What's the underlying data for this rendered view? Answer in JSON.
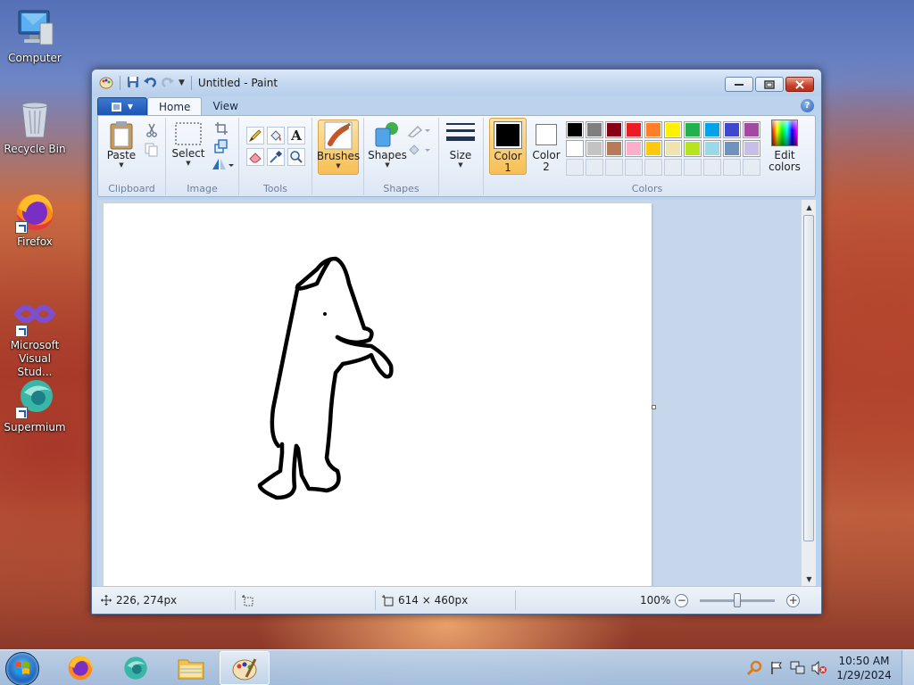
{
  "desktop": {
    "icons": [
      {
        "label": "Computer"
      },
      {
        "label": "Recycle Bin"
      },
      {
        "label": "Firefox"
      },
      {
        "label": "Microsoft Visual Stud..."
      },
      {
        "label": "Supermium"
      }
    ]
  },
  "window": {
    "title": "Untitled - Paint",
    "tabs": [
      {
        "label": "Home"
      },
      {
        "label": "View"
      }
    ],
    "groups": {
      "clipboard": {
        "label": "Clipboard",
        "paste": "Paste"
      },
      "image": {
        "label": "Image",
        "select": "Select"
      },
      "tools": {
        "label": "Tools"
      },
      "brushes": {
        "label": "Brushes"
      },
      "shapes": {
        "label": "Shapes",
        "shapes_btn": "Shapes"
      },
      "size": {
        "label": "Size"
      },
      "colors": {
        "label": "Colors",
        "color1_line1": "Color",
        "color1_line2": "1",
        "color2_line1": "Color",
        "color2_line2": "2",
        "edit_line1": "Edit",
        "edit_line2": "colors",
        "color1_value": "#000000",
        "color2_value": "#ffffff",
        "palette_row1": [
          "#000000",
          "#7f7f7f",
          "#880015",
          "#ed1c24",
          "#ff7f27",
          "#fff200",
          "#22b14c",
          "#00a2e8",
          "#3f48cc",
          "#a349a4"
        ],
        "palette_row2": [
          "#ffffff",
          "#c3c3c3",
          "#b97a57",
          "#ffaec9",
          "#ffc90e",
          "#efe4b0",
          "#b5e61d",
          "#99d9ea",
          "#7092be",
          "#c8bfe7"
        ]
      }
    },
    "status": {
      "cursor_pos": "226, 274px",
      "canvas_size": "614 × 460px",
      "zoom": "100%"
    }
  },
  "taskbar": {
    "time": "10:50 AM",
    "date": "1/29/2024"
  }
}
